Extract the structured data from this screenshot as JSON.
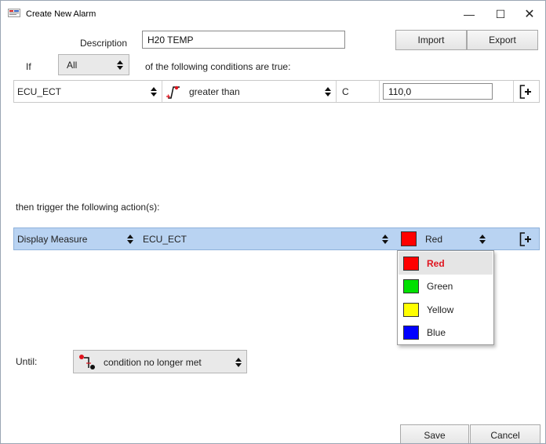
{
  "window": {
    "title": "Create New Alarm",
    "minimize_glyph": "—",
    "maximize_glyph": "☐",
    "close_glyph": "✕"
  },
  "form": {
    "description_label": "Description",
    "description_value": "H20 TEMP",
    "import_label": "Import",
    "export_label": "Export",
    "if_label": "If",
    "match_select": "All",
    "conditions_text": "of the following conditions are true:"
  },
  "condition": {
    "channel": "ECU_ECT",
    "operator": "greater than",
    "unit": "C",
    "value": "110,0"
  },
  "actions_heading": "then trigger the following action(s):",
  "action": {
    "type": "Display Measure",
    "channel": "ECU_ECT",
    "color_label": "Red",
    "color_hex": "#ff0000"
  },
  "color_options": [
    {
      "label": "Red",
      "hex": "#ff0000"
    },
    {
      "label": "Green",
      "hex": "#00e000"
    },
    {
      "label": "Yellow",
      "hex": "#ffff00"
    },
    {
      "label": "Blue",
      "hex": "#0000ff"
    }
  ],
  "until": {
    "label": "Until:",
    "value": "condition no longer met"
  },
  "footer": {
    "save_label": "Save",
    "cancel_label": "Cancel"
  },
  "icons": [
    "app-icon",
    "threshold-rise-icon",
    "add-row-icon",
    "updown-arrows-icon",
    "condition-end-icon"
  ]
}
